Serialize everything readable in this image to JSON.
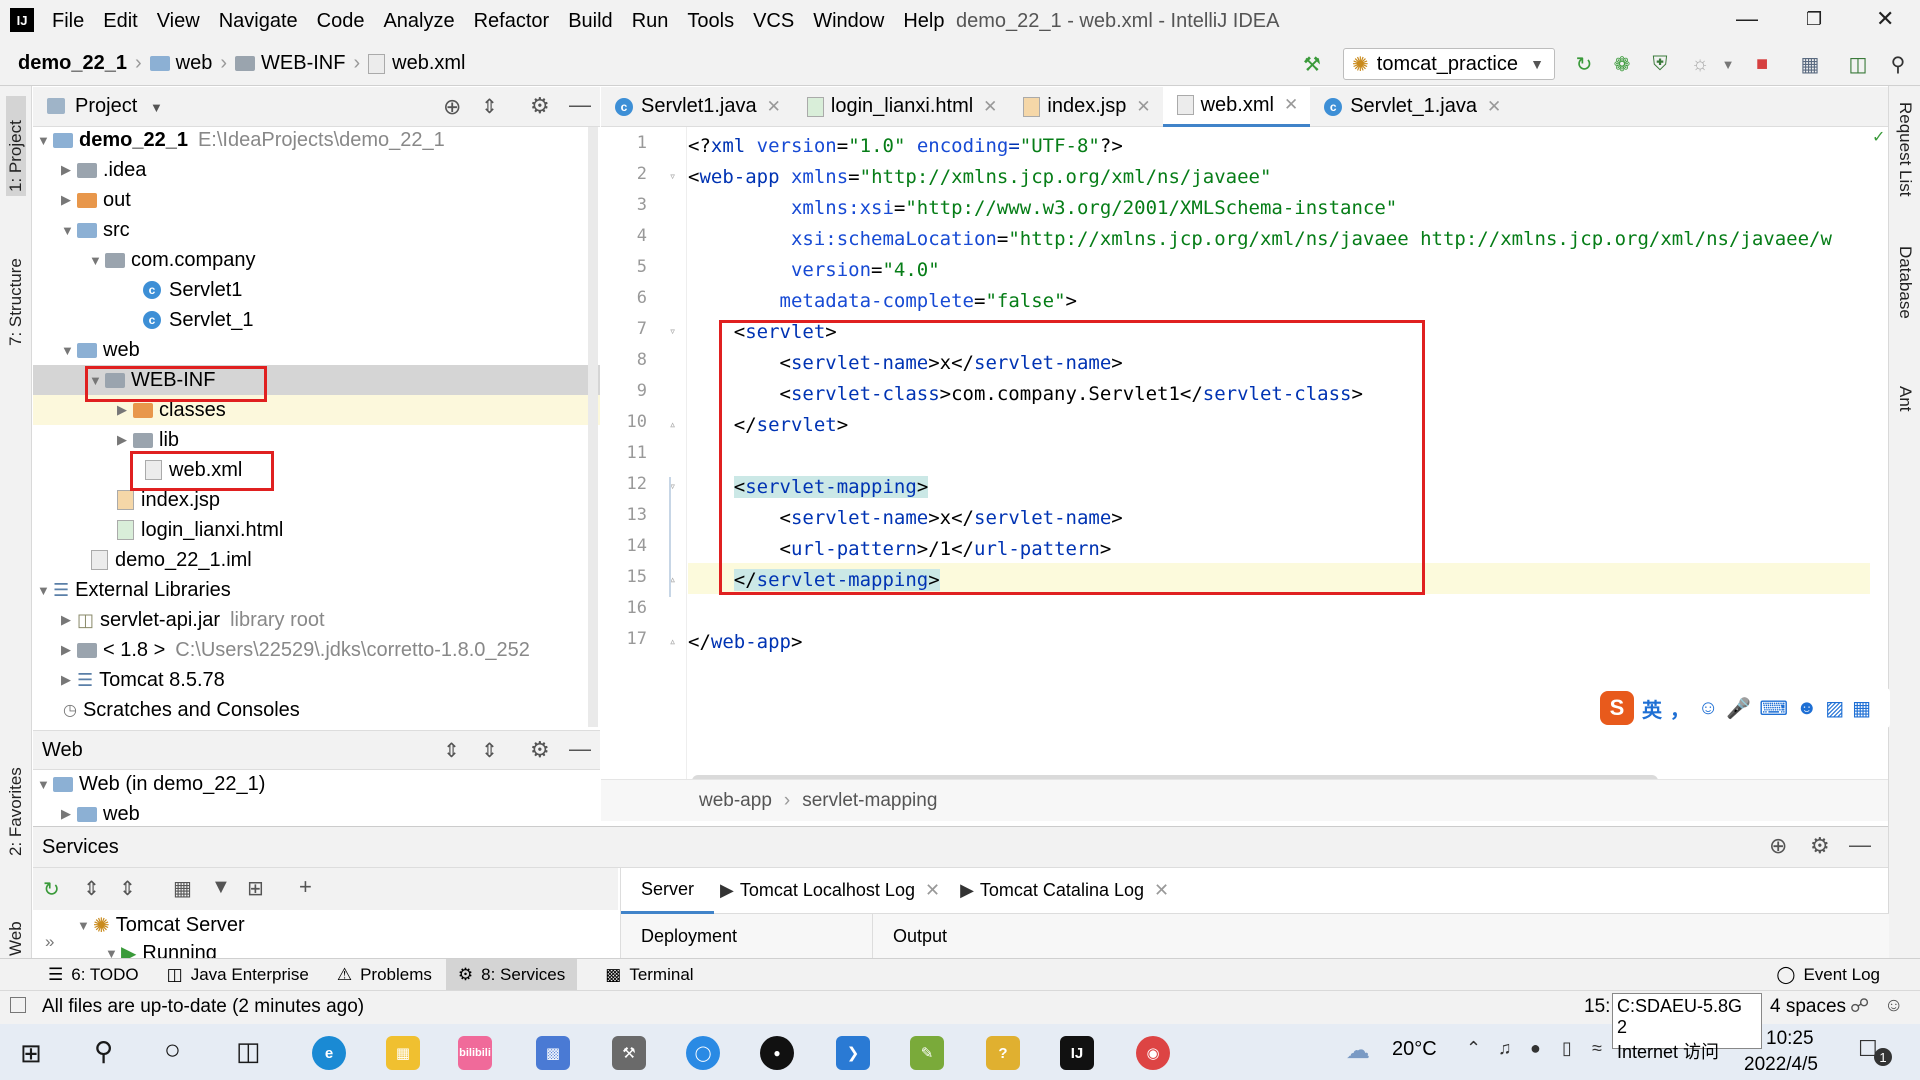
{
  "app": {
    "logo": "IJ",
    "window_title": "demo_22_1 - web.xml - IntelliJ IDEA",
    "menu": [
      "File",
      "Edit",
      "View",
      "Navigate",
      "Code",
      "Analyze",
      "Refactor",
      "Build",
      "Run",
      "Tools",
      "VCS",
      "Window",
      "Help"
    ]
  },
  "nav": {
    "crumbs": [
      "demo_22_1",
      "web",
      "WEB-INF",
      "web.xml"
    ],
    "run_config": "tomcat_practice"
  },
  "left_stripe": {
    "project": "1: Project",
    "structure": "7: Structure",
    "favorites": "2: Favorites",
    "web": "Web"
  },
  "right_stripe": {
    "request_list": "Request List",
    "database": "Database",
    "ant": "Ant"
  },
  "project": {
    "title": "Project",
    "tree": [
      {
        "label": "demo_22_1",
        "note": "E:\\IdeaProjects\\demo_22_1"
      },
      {
        "label": ".idea"
      },
      {
        "label": "out"
      },
      {
        "label": "src"
      },
      {
        "label": "com.company"
      },
      {
        "label": "Servlet1"
      },
      {
        "label": "Servlet_1"
      },
      {
        "label": "web"
      },
      {
        "label": "WEB-INF"
      },
      {
        "label": "classes"
      },
      {
        "label": "lib"
      },
      {
        "label": "web.xml"
      },
      {
        "label": "index.jsp"
      },
      {
        "label": "login_lianxi.html"
      },
      {
        "label": "demo_22_1.iml"
      },
      {
        "label": "External Libraries"
      },
      {
        "label": "servlet-api.jar",
        "note": "library root"
      },
      {
        "label": "< 1.8 >",
        "note": "C:\\Users\\22529\\.jdks\\corretto-1.8.0_252"
      },
      {
        "label": "Tomcat 8.5.78"
      },
      {
        "label": "Scratches and Consoles"
      }
    ]
  },
  "web_panel": {
    "title": "Web",
    "tree": [
      {
        "label": "Web (in demo_22_1)"
      },
      {
        "label": "web"
      }
    ]
  },
  "tabs": [
    {
      "label": "Servlet1.java"
    },
    {
      "label": "login_lianxi.html"
    },
    {
      "label": "index.jsp"
    },
    {
      "label": "web.xml"
    },
    {
      "label": "Servlet_1.java"
    }
  ],
  "editor": {
    "line_numbers": [
      "1",
      "2",
      "3",
      "4",
      "5",
      "6",
      "7",
      "8",
      "9",
      "10",
      "11",
      "12",
      "13",
      "14",
      "15",
      "16",
      "17"
    ],
    "breadcrumb": [
      "web-app",
      "servlet-mapping"
    ],
    "lines": [
      {
        "a": "<?",
        "b": "xml ",
        "c": "version",
        "d": "=",
        "e": "\"1.0\"",
        "f": " encoding",
        "g": "=",
        "h": "\"UTF-8\"",
        "i": "?>"
      },
      {
        "a": "<",
        "b": "web-app ",
        "c": "xmlns",
        "d": "=",
        "e": "\"http://xmlns.jcp.org/xml/ns/javaee\"",
        "f": "",
        "g": "",
        "h": "",
        "i": ""
      },
      {
        "a": "         ",
        "b": "",
        "c": "xmlns:xsi",
        "d": "=",
        "e": "\"http://www.w3.org/2001/XMLSchema-instance\"",
        "f": "",
        "g": "",
        "h": "",
        "i": ""
      },
      {
        "a": "         ",
        "b": "",
        "c": "xsi:schemaLocation",
        "d": "=",
        "e": "\"http://xmlns.jcp.org/xml/ns/javaee http://xmlns.jcp.org/xml/ns/javaee/w",
        "f": "",
        "g": "",
        "h": "",
        "i": ""
      },
      {
        "a": "         ",
        "b": "",
        "c": "version",
        "d": "=",
        "e": "\"4.0\"",
        "f": "",
        "g": "",
        "h": "",
        "i": ""
      },
      {
        "a": "        ",
        "b": "",
        "c": "metadata-complete",
        "d": "=",
        "e": "\"false\"",
        "f": "",
        "g": "",
        "h": "",
        "i": ">"
      },
      {
        "a": "    <",
        "b": "servlet",
        "c": "",
        "d": "",
        "e": "",
        "f": "",
        "g": "",
        "h": "",
        "i": ">"
      },
      {
        "a": "        <",
        "b": "servlet-name",
        "c": "",
        "d": "",
        "e": "",
        "f": ">x</",
        "g": "servlet-name",
        "h": "",
        "i": ">"
      },
      {
        "a": "        <",
        "b": "servlet-class",
        "c": "",
        "d": "",
        "e": "",
        "f": ">com.company.Servlet1</",
        "g": "servlet-class",
        "h": "",
        "i": ">"
      },
      {
        "a": "    </",
        "b": "servlet",
        "c": "",
        "d": "",
        "e": "",
        "f": "",
        "g": "",
        "h": "",
        "i": ">"
      },
      {
        "a": "",
        "b": "",
        "c": "",
        "d": "",
        "e": "",
        "f": "",
        "g": "",
        "h": "",
        "i": ""
      },
      {
        "a": "    <",
        "b": "servlet-mapping",
        "c": "",
        "d": "",
        "e": "",
        "f": "",
        "g": "",
        "h": "",
        "i": ">"
      },
      {
        "a": "        <",
        "b": "servlet-name",
        "c": "",
        "d": "",
        "e": "",
        "f": ">x</",
        "g": "servlet-name",
        "h": "",
        "i": ">"
      },
      {
        "a": "        <",
        "b": "url-pattern",
        "c": "",
        "d": "",
        "e": "",
        "f": ">/1</",
        "g": "url-pattern",
        "h": "",
        "i": ">"
      },
      {
        "a": "    </",
        "b": "servlet-mapping",
        "c": "",
        "d": "",
        "e": "",
        "f": "",
        "g": "",
        "h": "",
        "i": ">"
      },
      {
        "a": "",
        "b": "",
        "c": "",
        "d": "",
        "e": "",
        "f": "",
        "g": "",
        "h": "",
        "i": ""
      },
      {
        "a": "</",
        "b": "web-app",
        "c": "",
        "d": "",
        "e": "",
        "f": "",
        "g": "",
        "h": "",
        "i": ">"
      }
    ]
  },
  "ime": {
    "lang": "英",
    "punct": "，"
  },
  "services": {
    "title": "Services",
    "tree": [
      {
        "label": "Tomcat Server"
      },
      {
        "label": "Running"
      }
    ],
    "tabs": [
      "Server",
      "Tomcat Localhost Log",
      "Tomcat Catalina Log"
    ],
    "subtabs": [
      "Deployment",
      "Output"
    ]
  },
  "toolwindows": [
    "6: TODO",
    "Java Enterprise",
    "Problems",
    "8: Services",
    "Terminal"
  ],
  "event_log": "Event Log",
  "status": {
    "message": "All files are up-to-date (2 minutes ago)",
    "position": "15:",
    "indent": "4 spaces",
    "tooltip_line1": "C:SDAEU-5.8G 2",
    "tooltip_line2": "Internet 访问"
  },
  "taskbar": {
    "temperature": "20°C",
    "time": "10:25",
    "date": "2022/4/5",
    "bilibili": "bilibili",
    "notif_count": "1"
  },
  "colors": {
    "accent": "#4083c9",
    "highlight_box": "#e02020",
    "tag": "#0033b3",
    "value": "#067d17"
  }
}
